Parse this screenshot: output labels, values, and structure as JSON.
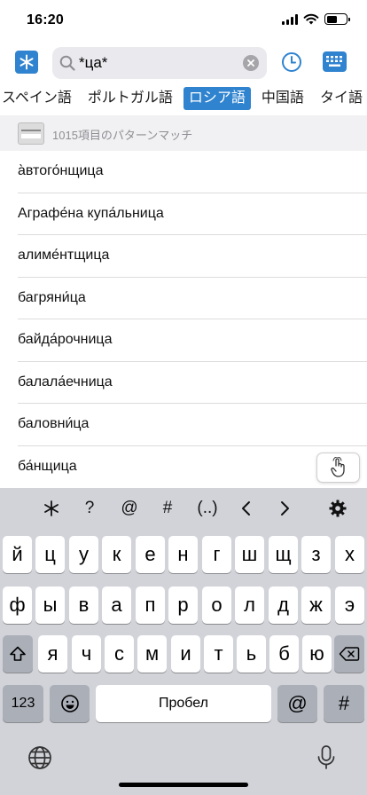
{
  "status": {
    "time": "16:20"
  },
  "search": {
    "query": "*ца*"
  },
  "languages": [
    "スペイン語",
    "ポルトガル語",
    "ロシア語",
    "中国語",
    "タイ語"
  ],
  "active_language": "ロシア語",
  "dictionary": {
    "badge": "СЛОВАРЬ",
    "match_text": "1015項目のパターンマッチ"
  },
  "results": [
    "а̀втого́нщица",
    "Аграфе́на купа́льница",
    "алиме́нтщица",
    "багряни́ца",
    "байда́рочница",
    "балала́ечница",
    "баловни́ца",
    "ба́нщица"
  ],
  "keyboard": {
    "accessory": [
      "∗",
      "?",
      "@",
      "#",
      "(..)",
      "‹",
      "›",
      "⚙"
    ],
    "row1": [
      "й",
      "ц",
      "у",
      "к",
      "е",
      "н",
      "г",
      "ш",
      "щ",
      "з",
      "х"
    ],
    "row2": [
      "ф",
      "ы",
      "в",
      "а",
      "п",
      "р",
      "о",
      "л",
      "д",
      "ж",
      "э"
    ],
    "row3": [
      "я",
      "ч",
      "с",
      "м",
      "и",
      "т",
      "ь",
      "б",
      "ю"
    ],
    "numbers_label": "123",
    "space_label": "Пробел",
    "at_label": "@",
    "hash_label": "#"
  },
  "colors": {
    "accent": "#2f83cf",
    "keyboard_bg": "#d1d3d9",
    "dark_key": "#abafb8"
  },
  "icons": {
    "wildcard": "asterisk-icon",
    "search": "search-icon",
    "clear": "clear-icon",
    "history": "clock-icon",
    "keyboard": "keyboard-icon",
    "tap": "hand-pointer-icon",
    "globe": "globe-icon",
    "mic": "microphone-icon",
    "shift": "shift-icon",
    "backspace": "backspace-icon",
    "emoji": "emoji-icon"
  }
}
